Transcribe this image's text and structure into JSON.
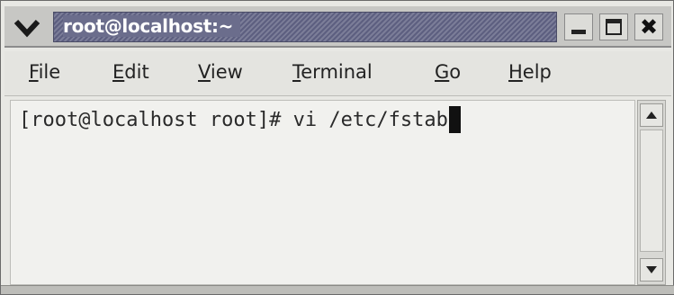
{
  "window": {
    "title": "root@localhost:~",
    "controls": {
      "menu": "chevron-down-icon",
      "minimize": "minimize-icon",
      "maximize": "maximize-icon",
      "close": "close-icon",
      "close_glyph": "✖"
    }
  },
  "menubar": {
    "items": [
      {
        "label": "File"
      },
      {
        "label": "Edit"
      },
      {
        "label": "View"
      },
      {
        "label": "Terminal"
      },
      {
        "label": "Go"
      },
      {
        "label": "Help"
      }
    ]
  },
  "terminal": {
    "prompt": "[root@localhost root]# ",
    "command": "vi /etc/fstab"
  },
  "scrollbar": {
    "up_icon": "arrow-up-icon",
    "down_icon": "arrow-down-icon"
  },
  "colors": {
    "title_strip": "#6b6d8c",
    "title_text": "#ffffff",
    "terminal_bg": "#f1f1ee",
    "terminal_text": "#2a2a2a"
  }
}
